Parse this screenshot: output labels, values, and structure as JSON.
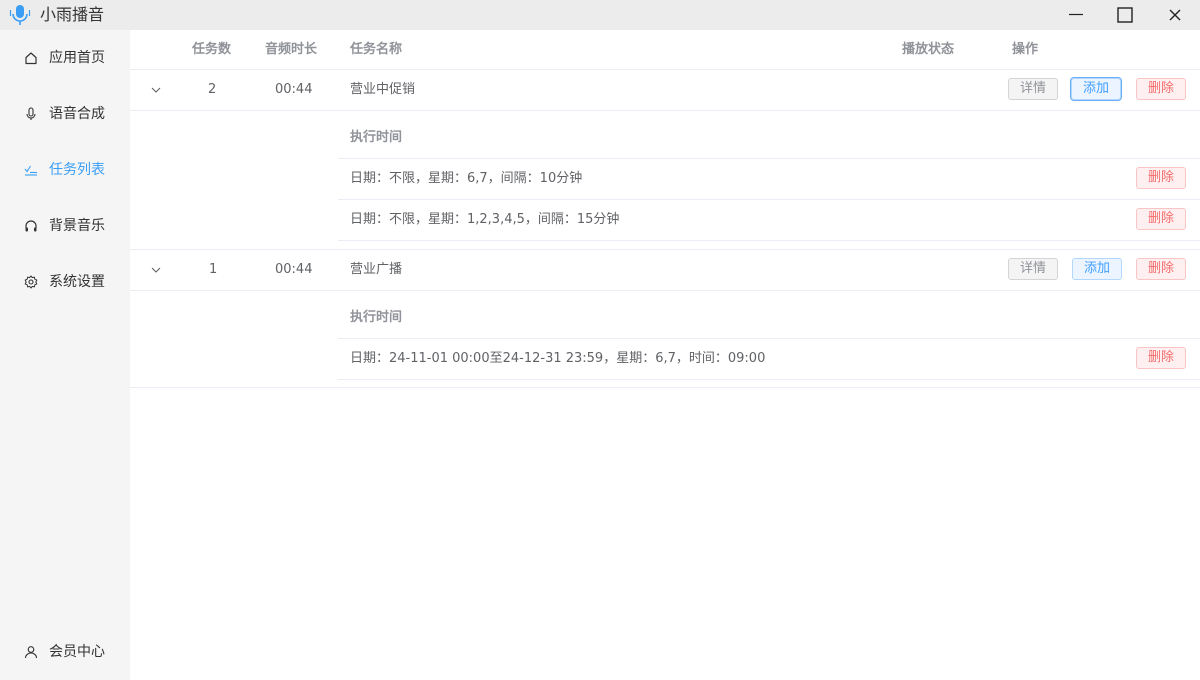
{
  "window": {
    "title": "小雨播音"
  },
  "sidebar": {
    "items": [
      {
        "label": "应用首页",
        "icon": "home-icon"
      },
      {
        "label": "语音合成",
        "icon": "microphone-icon"
      },
      {
        "label": "任务列表",
        "icon": "task-list-icon",
        "active": true
      },
      {
        "label": "背景音乐",
        "icon": "headphones-icon"
      },
      {
        "label": "系统设置",
        "icon": "gear-icon"
      }
    ],
    "footer": {
      "label": "会员中心",
      "icon": "user-icon"
    }
  },
  "table": {
    "headers": {
      "task_count": "任务数",
      "duration": "音频时长",
      "name": "任务名称",
      "status": "播放状态",
      "actions": "操作"
    },
    "rows": [
      {
        "task_count": "2",
        "duration": "00:44",
        "name": "营业中促销",
        "status": "",
        "buttons": {
          "detail": "详情",
          "add": "添加",
          "delete": "删除"
        },
        "schedule_header": "执行时间",
        "schedules": [
          {
            "text": "日期：不限，星期：6,7，间隔：10分钟",
            "delete": "删除"
          },
          {
            "text": "日期：不限，星期：1,2,3,4,5，间隔：15分钟",
            "delete": "删除"
          }
        ]
      },
      {
        "task_count": "1",
        "duration": "00:44",
        "name": "营业广播",
        "status": "",
        "buttons": {
          "detail": "详情",
          "add": "添加",
          "delete": "删除"
        },
        "schedule_header": "执行时间",
        "schedules": [
          {
            "text": "日期：24-11-01 00:00至24-12-31 23:59，星期：6,7，时间：09:00",
            "delete": "删除"
          }
        ]
      }
    ]
  },
  "colors": {
    "accent": "#3a9ef5",
    "sidebar_bg": "#f5f5f5",
    "titlebar_bg": "#ececec",
    "danger": "#f56c6c"
  }
}
